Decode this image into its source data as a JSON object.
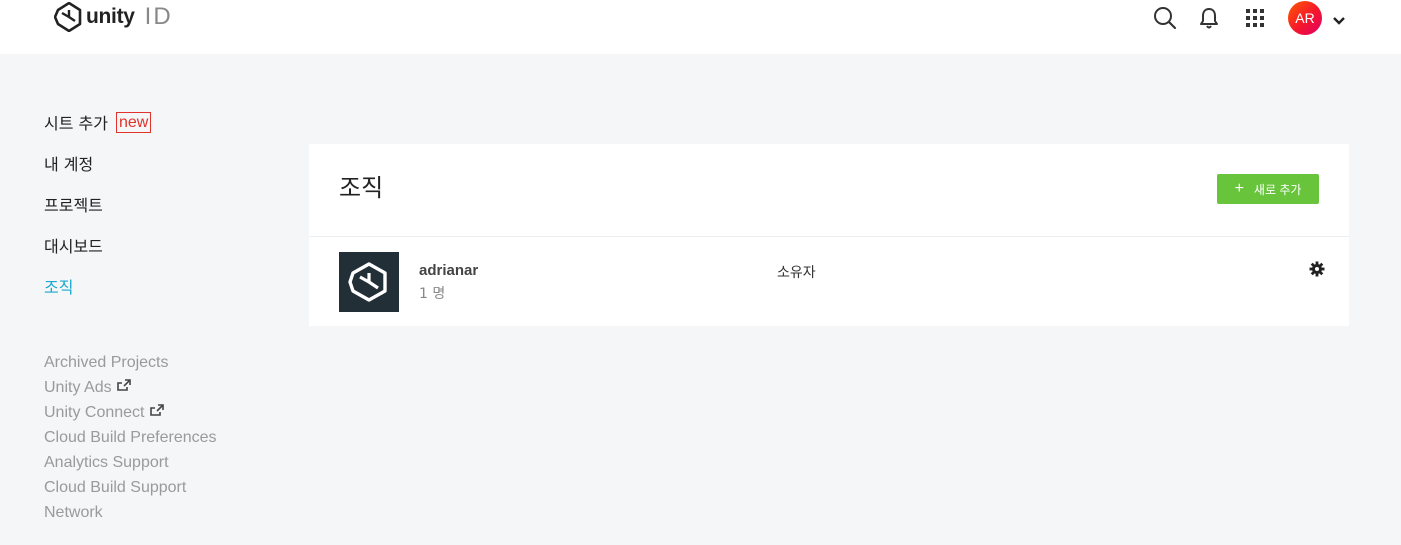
{
  "header": {
    "logo_word": "unity",
    "logo_suffix": "ID",
    "avatar_initials": "AR"
  },
  "sidebar": {
    "items": [
      {
        "label": "시트 추가",
        "badge": "new"
      },
      {
        "label": "내 계정"
      },
      {
        "label": "프로젝트"
      },
      {
        "label": "대시보드"
      },
      {
        "label": "조직",
        "active": true
      }
    ],
    "links": [
      {
        "label": "Archived Projects"
      },
      {
        "label": "Unity Ads",
        "external": true
      },
      {
        "label": "Unity Connect",
        "external": true
      },
      {
        "label": "Cloud Build Preferences"
      },
      {
        "label": "Analytics Support"
      },
      {
        "label": "Cloud Build Support"
      },
      {
        "label": "Network"
      }
    ]
  },
  "main": {
    "title": "조직",
    "add_button": {
      "plus": "+",
      "label": "새로 추가"
    },
    "organizations": [
      {
        "name": "adrianar",
        "members": "1 명",
        "role": "소유자"
      }
    ]
  },
  "colors": {
    "accent_active": "#19a9d0",
    "add_button": "#67c43b",
    "badge": "#e0332b",
    "org_logo_bg": "#232f37"
  }
}
